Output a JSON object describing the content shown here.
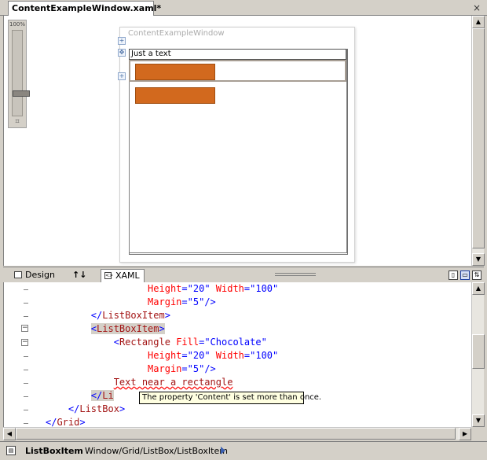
{
  "document_tab": {
    "title": "ContentExampleWindow.xaml*"
  },
  "close_glyph": "×",
  "zoom": {
    "label": "100%",
    "fit_glyph": "⌗"
  },
  "design": {
    "window_title": "ContentExampleWindow",
    "listbox_text_item": "Just a text",
    "rectangle_fill": "#d2691e"
  },
  "splitter": {
    "design_tab": "Design",
    "swap_glyph": "↑↓",
    "xaml_tab": "XAML"
  },
  "code": {
    "lines": [
      {
        "indent": "                  ",
        "parts": [
          [
            "attr",
            "Height"
          ],
          [
            "brk",
            "=\""
          ],
          [
            "val",
            "20"
          ],
          [
            "brk",
            "\" "
          ],
          [
            "attr",
            "Width"
          ],
          [
            "brk",
            "=\""
          ],
          [
            "val",
            "100"
          ],
          [
            "brk",
            "\""
          ]
        ]
      },
      {
        "indent": "                  ",
        "parts": [
          [
            "attr",
            "Margin"
          ],
          [
            "brk",
            "=\""
          ],
          [
            "val",
            "5"
          ],
          [
            "brk",
            "\"/>"
          ]
        ]
      },
      {
        "indent": "        ",
        "parts": [
          [
            "brk",
            "</"
          ],
          [
            "tagc",
            "ListBoxItem"
          ],
          [
            "brk",
            ">"
          ]
        ]
      },
      {
        "indent": "        ",
        "parts": [
          [
            "brk",
            "<"
          ],
          [
            "tagc",
            "ListBoxItem"
          ],
          [
            "brk",
            ">"
          ]
        ]
      },
      {
        "indent": "            ",
        "parts": [
          [
            "brk",
            "<"
          ],
          [
            "tagc",
            "Rectangle "
          ],
          [
            "attr",
            "Fill"
          ],
          [
            "brk",
            "=\""
          ],
          [
            "val",
            "Chocolate"
          ],
          [
            "brk",
            "\""
          ]
        ]
      },
      {
        "indent": "                  ",
        "parts": [
          [
            "attr",
            "Height"
          ],
          [
            "brk",
            "=\""
          ],
          [
            "val",
            "20"
          ],
          [
            "brk",
            "\" "
          ],
          [
            "attr",
            "Width"
          ],
          [
            "brk",
            "=\""
          ],
          [
            "val",
            "100"
          ],
          [
            "brk",
            "\""
          ]
        ]
      },
      {
        "indent": "                  ",
        "parts": [
          [
            "attr",
            "Margin"
          ],
          [
            "brk",
            "=\""
          ],
          [
            "val",
            "5"
          ],
          [
            "brk",
            "\"/>"
          ]
        ]
      },
      {
        "indent": "            ",
        "parts": [
          [
            "err",
            "Text near a rectangle"
          ]
        ]
      },
      {
        "indent": "        ",
        "parts": [
          [
            "brk",
            "</"
          ],
          [
            "tagc",
            "Li"
          ]
        ]
      },
      {
        "indent": "    ",
        "parts": [
          [
            "brk",
            "</"
          ],
          [
            "tagc",
            "ListBox"
          ],
          [
            "brk",
            ">"
          ]
        ]
      },
      {
        "indent": "",
        "parts": [
          [
            "brk",
            "</"
          ],
          [
            "tagc",
            "Grid"
          ],
          [
            "brk",
            ">"
          ]
        ]
      }
    ],
    "error_tooltip": "The property 'Content' is set more than once."
  },
  "status": {
    "element": "ListBoxItem",
    "path": "Window/Grid/ListBox/ListBoxItem"
  }
}
